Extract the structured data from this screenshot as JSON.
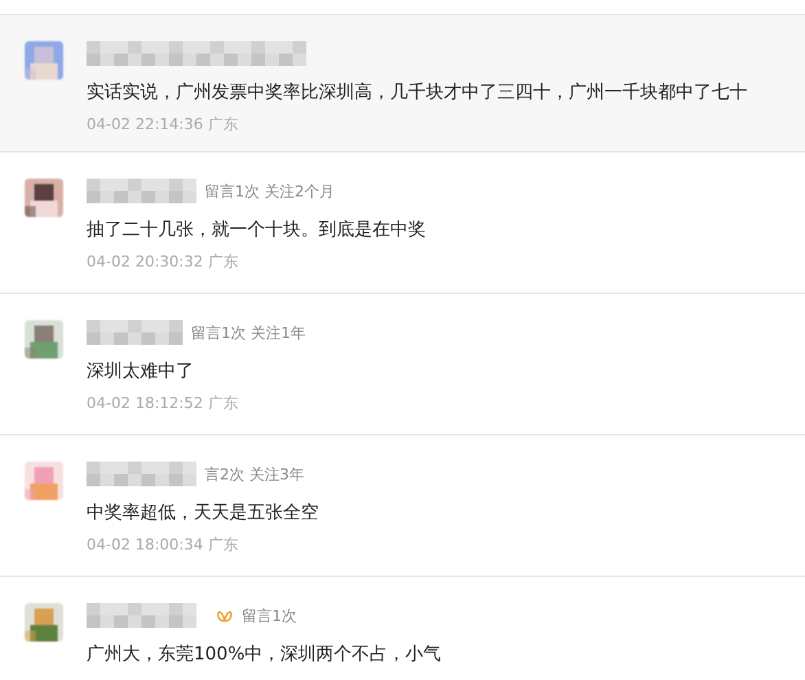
{
  "comments": [
    {
      "highlighted": true,
      "badge": false,
      "text": "实话实说，广州发票中奖率比深圳高，几千块才中了三四十，广州一千块都中了七十",
      "time": "04-02 22:14:36 广东"
    },
    {
      "highlighted": false,
      "meta": "留言1次 关注2个月",
      "badge": false,
      "text": "抽了二十几张，就一个十块。到底是在中奖",
      "time": "04-02 20:30:32 广东"
    },
    {
      "highlighted": false,
      "meta": "留言1次 关注1年",
      "badge": false,
      "text": "深圳太难中了",
      "time": "04-02 18:12:52 广东"
    },
    {
      "highlighted": false,
      "meta": "言2次 关注3年",
      "badge": false,
      "text": "中奖率超低，天天是五张全空",
      "time": "04-02 18:00:34 广东"
    },
    {
      "highlighted": false,
      "meta": "留言1次",
      "badge": true,
      "text": "广州大，东莞100%中，深圳两个不占，小气"
    }
  ]
}
